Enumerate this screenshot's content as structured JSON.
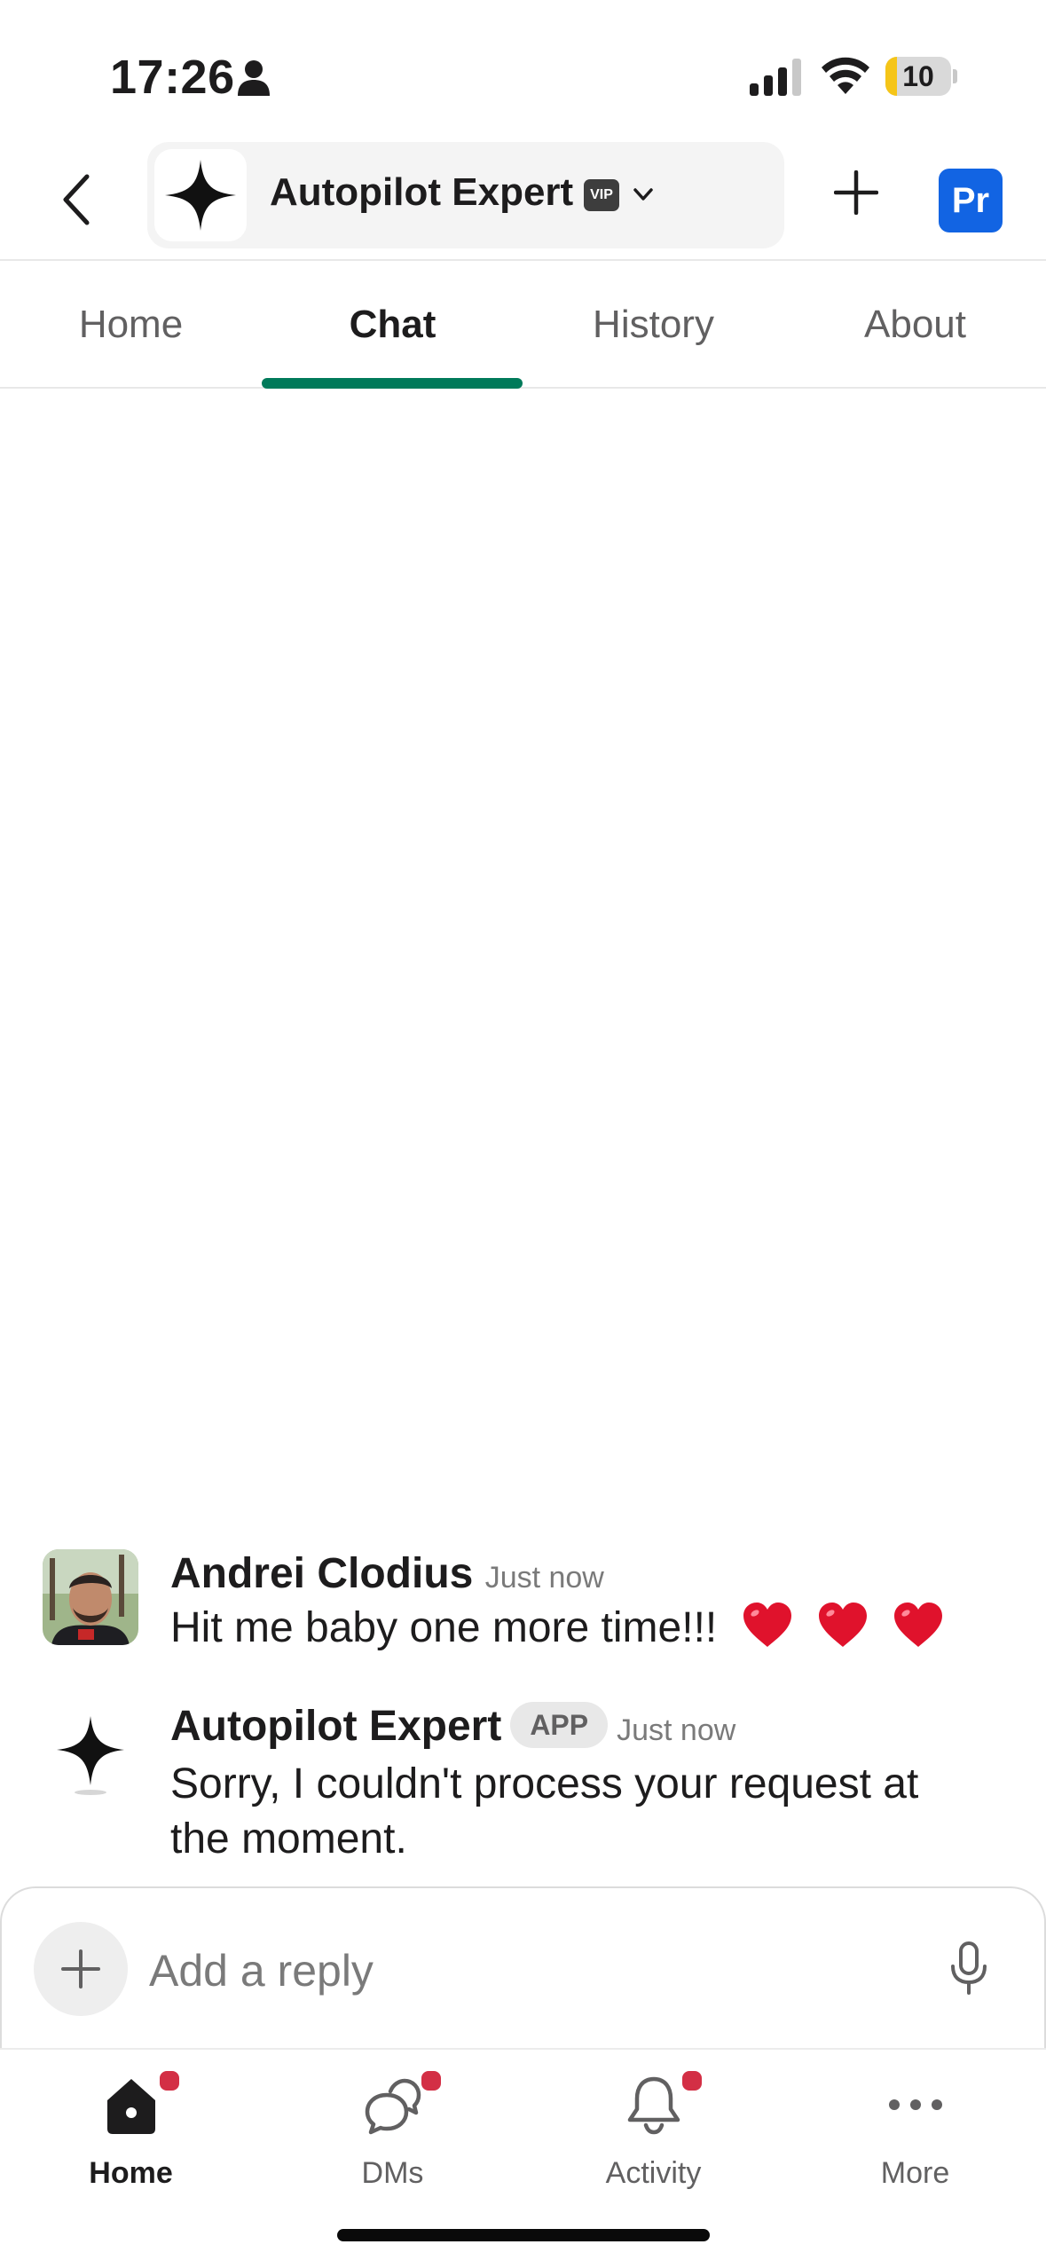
{
  "status_bar": {
    "time": "17:26",
    "battery": "10",
    "battery_level": 0.1
  },
  "header": {
    "back_icon": "chevron-left-icon",
    "channel_name": "Autopilot Expert",
    "vip_badge": "VIP",
    "add_icon": "plus-icon",
    "profile_initials": "Pr",
    "accent_color": "#1264e3"
  },
  "tabs": [
    {
      "label": "Home",
      "active": false
    },
    {
      "label": "Chat",
      "active": true
    },
    {
      "label": "History",
      "active": false
    },
    {
      "label": "About",
      "active": false
    }
  ],
  "tab_accent_color": "#007a5a",
  "messages": [
    {
      "author": "Andrei Clodius",
      "time": "Just now",
      "text": "Hit me baby one more time!!!",
      "emoji": [
        "heart-emoji",
        "heart-emoji",
        "heart-emoji"
      ]
    },
    {
      "author": "Autopilot Expert",
      "badge": "APP",
      "time": "Just now",
      "text": "Sorry, I couldn't process your request at the moment."
    }
  ],
  "composer": {
    "placeholder": "Add a reply",
    "plus_icon": "plus-icon",
    "mic_icon": "microphone-icon"
  },
  "bottom_nav": [
    {
      "label": "Home",
      "icon": "home-icon",
      "active": true,
      "badge": true
    },
    {
      "label": "DMs",
      "icon": "dms-icon",
      "active": false,
      "badge": true
    },
    {
      "label": "Activity",
      "icon": "bell-icon",
      "active": false,
      "badge": true
    },
    {
      "label": "More",
      "icon": "more-icon",
      "active": false,
      "badge": false
    }
  ],
  "badge_color": "#d32f45"
}
